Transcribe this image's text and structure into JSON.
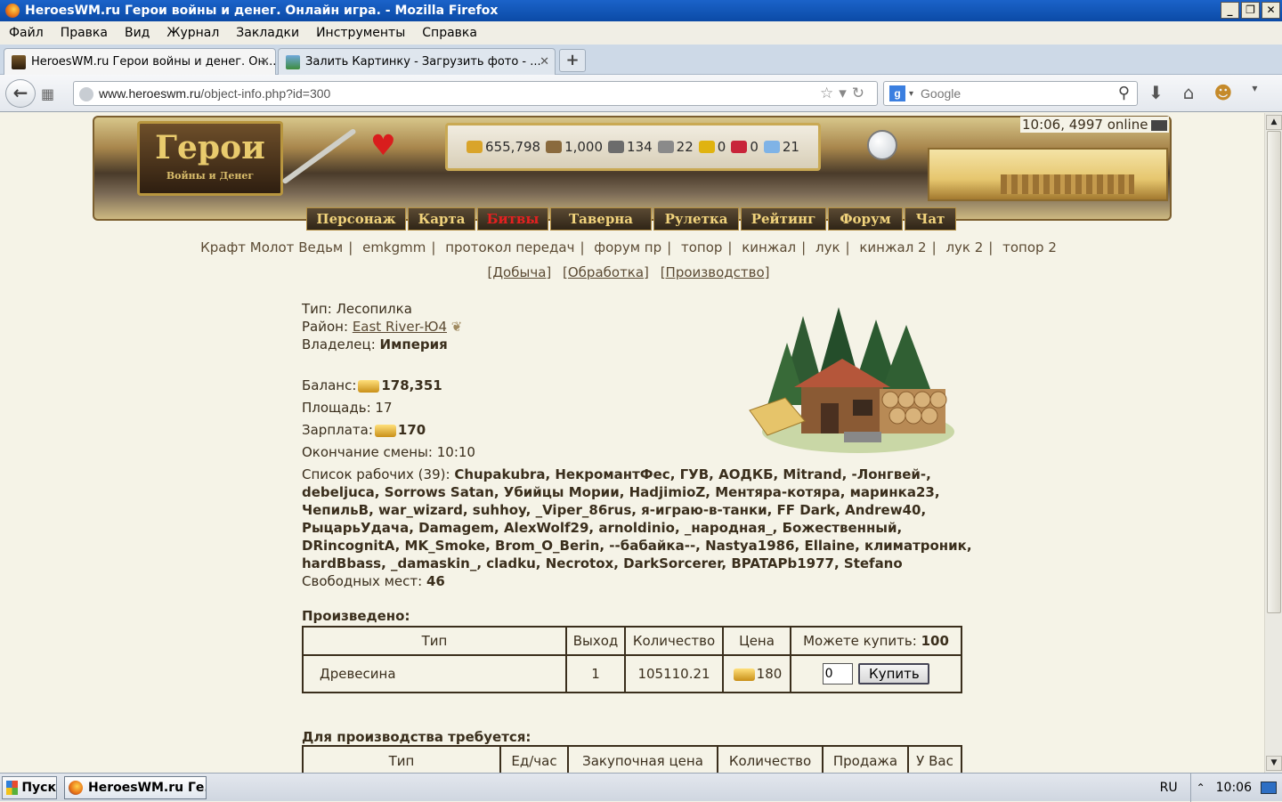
{
  "window": {
    "title": "HeroesWM.ru Герои войны и денег. Онлайн игра. - Mozilla Firefox",
    "controls": [
      "_",
      "❐",
      "✕"
    ]
  },
  "menu": [
    "Файл",
    "Правка",
    "Вид",
    "Журнал",
    "Закладки",
    "Инструменты",
    "Справка"
  ],
  "tabs": [
    {
      "label": "HeroesWM.ru Герои войны и денег. Он...",
      "active": true
    },
    {
      "label": "Залить Картинку - Загрузить фото - ...",
      "active": false
    }
  ],
  "newtab": "+",
  "url": {
    "domain": "www.heroeswm.ru",
    "path": "/object-info.php?id=300"
  },
  "search": {
    "placeholder": "Google",
    "engine": "g"
  },
  "banner": {
    "logo_main": "Герои",
    "logo_sub": "Войны и Денег",
    "resources": [
      {
        "name": "gold",
        "value": "655,798",
        "color": "#d9a42a"
      },
      {
        "name": "wood",
        "value": "1,000",
        "color": "#8a6a3d"
      },
      {
        "name": "ore",
        "value": "134",
        "color": "#6c6c6c"
      },
      {
        "name": "mercury",
        "value": "22",
        "color": "#8a8a8a"
      },
      {
        "name": "sulfur",
        "value": "0",
        "color": "#e0b310"
      },
      {
        "name": "crystals",
        "value": "0",
        "color": "#c8243a"
      },
      {
        "name": "gems",
        "value": "21",
        "color": "#7fb3e6"
      }
    ],
    "online": "10:06, 4997 online"
  },
  "nav": [
    "Персонаж",
    "Карта",
    "Битвы",
    "Таверна",
    "Рулетка",
    "Рейтинг",
    "Форум",
    "Чат"
  ],
  "sublinks": [
    "Крафт Молот Ведьм",
    "emkgmm",
    "протокол передач",
    "форум пр",
    "топор",
    "кинжал",
    "лук",
    "кинжал 2",
    "лук 2",
    "топор 2"
  ],
  "sublinks2": [
    "[Добыча]",
    "[Обработка]",
    "[Производство]"
  ],
  "object": {
    "type_label": "Тип:",
    "type_value": "Лесопилка",
    "district_label": "Район:",
    "district_value": "East River-Ю4",
    "owner_label": "Владелец:",
    "owner_value": "Империя",
    "balance_label": "Баланс:",
    "balance_value": "178,351",
    "area_label": "Площадь:",
    "area_value": "17",
    "salary_label": "Зарплата:",
    "salary_value": "170",
    "shift_label": "Окончание смены:",
    "shift_value": "10:10",
    "workers_label": "Список рабочих (39):",
    "workers_text": "Chupakubra, НекромантФес, ГУВ, АОДКБ, Mitrand, -Лонгвей-, debeljuca, Sorrows Satan, Убийцы Мории, HadjimioZ, Ментяра-котяра, маринка23, ЧепильВ, war_wizard, suhhoy, _Viper_86rus, я-играю-в-танки, FF Dark, Andrew40, РыцарьУдача, Damagem, AlexWolf29, arnoldinio, _народная_, Божественный, DRincognitA, MK_Smoke, Brom_O_Berin, --бабайка--, Nastya1986, Ellaine, климатроник, hardBbass, _damaskin_, cladku, Necrotox, DarkSorcerer, BPATAPb1977, Stefano",
    "free_label": "Свободных мест:",
    "free_value": "46"
  },
  "produced": {
    "title": "Произведено:",
    "headers": [
      "Тип",
      "Выход",
      "Количество",
      "Цена",
      "Можете купить:"
    ],
    "can_buy": "100",
    "row": {
      "type": "Древесина",
      "output": "1",
      "quantity": "105110.21",
      "price": "180"
    },
    "qty_input": "0",
    "buy_label": "Купить"
  },
  "required": {
    "title": "Для производства требуется:",
    "headers": [
      "Тип",
      "Ед/час",
      "Закупочная цена",
      "Количество",
      "Продажа",
      "У Вас"
    ]
  },
  "taskbar": {
    "start": "Пуск",
    "item": "HeroesWM.ru Ге...",
    "lang": "RU",
    "clock": "10:06"
  }
}
